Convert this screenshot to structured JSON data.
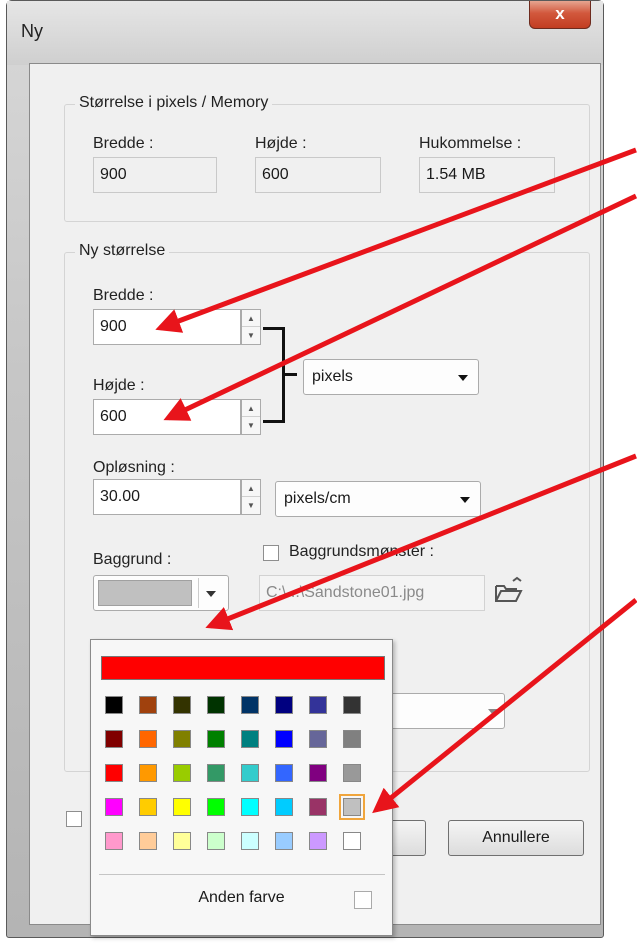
{
  "window": {
    "title": "Ny",
    "close_label": "x"
  },
  "size_group": {
    "legend": "Størrelse i pixels / Memory",
    "width_label": "Bredde :",
    "width_value": "900",
    "height_label": "Højde :",
    "height_value": "600",
    "memory_label": "Hukommelse :",
    "memory_value": "1.54 MB"
  },
  "new_size_group": {
    "legend": "Ny størrelse",
    "width_label": "Bredde :",
    "width_value": "900",
    "height_label": "Højde :",
    "height_value": "600",
    "unit_selected": "pixels",
    "resolution_label": "Opløsning :",
    "resolution_value": "30.00",
    "resolution_unit": "pixels/cm",
    "background_label": "Baggrund :",
    "pattern_label": "Baggrundsmønster :",
    "pattern_file": "C:\\...\\Sandstone01.jpg"
  },
  "buttons": {
    "cancel": "Annullere"
  },
  "color_popup": {
    "current_color": "#ff0000",
    "swatches": [
      [
        "#000000",
        "#a0410d",
        "#333300",
        "#003300",
        "#003366",
        "#000080",
        "#333399",
        "#333333"
      ],
      [
        "#800000",
        "#ff6600",
        "#808000",
        "#008000",
        "#008080",
        "#0000ff",
        "#666699",
        "#808080"
      ],
      [
        "#ff0000",
        "#ff9900",
        "#99cc00",
        "#339966",
        "#33cccc",
        "#3366ff",
        "#800080",
        "#999999"
      ],
      [
        "#ff00ff",
        "#ffcc00",
        "#ffff00",
        "#00ff00",
        "#00ffff",
        "#00ccff",
        "#993366",
        "#c0c0c0"
      ],
      [
        "#ff99cc",
        "#ffcc99",
        "#ffff99",
        "#ccffcc",
        "#ccffff",
        "#99ccff",
        "#cc99ff",
        "#ffffff"
      ]
    ],
    "selected": {
      "row": 3,
      "col": 7
    },
    "other_color_label": "Anden farve"
  },
  "colors": {
    "annotation_arrow": "#e8141b",
    "background_swatch": "#c0c0c0"
  }
}
